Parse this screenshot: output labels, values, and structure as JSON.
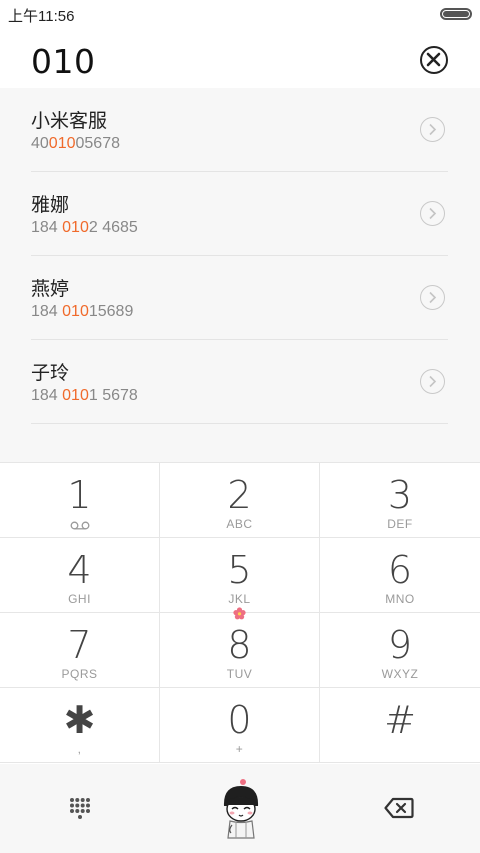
{
  "status_bar": {
    "time": "上午11:56"
  },
  "dialer": {
    "number": "010"
  },
  "contacts": [
    {
      "name": "小米客服",
      "number_pre": "40",
      "number_match": "010",
      "number_post": "05678"
    },
    {
      "name": "雅娜",
      "number_pre": "184 ",
      "number_match": "010",
      "number_post": "2 4685"
    },
    {
      "name": "燕婷",
      "number_pre": "184 ",
      "number_match": "010",
      "number_post": "15689"
    },
    {
      "name": "子玲",
      "number_pre": "184 ",
      "number_match": "010",
      "number_post": "1 5678"
    }
  ],
  "keypad": [
    {
      "digit": "1",
      "letters": ""
    },
    {
      "digit": "2",
      "letters": "ABC"
    },
    {
      "digit": "3",
      "letters": "DEF"
    },
    {
      "digit": "4",
      "letters": "GHI"
    },
    {
      "digit": "5",
      "letters": "JKL"
    },
    {
      "digit": "6",
      "letters": "MNO"
    },
    {
      "digit": "7",
      "letters": "PQRS"
    },
    {
      "digit": "8",
      "letters": "TUV"
    },
    {
      "digit": "9",
      "letters": "WXYZ"
    },
    {
      "digit": "✱",
      "letters": ","
    },
    {
      "digit": "0",
      "letters": "+"
    },
    {
      "digit": "#",
      "letters": ""
    }
  ],
  "icons": {
    "clear": "clear-circle-x-icon",
    "detail": "chevron-right-circle-icon",
    "voicemail": "voicemail-icon",
    "keypad_toggle": "keypad-grid-icon",
    "dial": "cartoon-dial-icon",
    "backspace": "backspace-icon"
  },
  "colors": {
    "highlight": "#f06a2b",
    "background": "#f7f7f7"
  }
}
